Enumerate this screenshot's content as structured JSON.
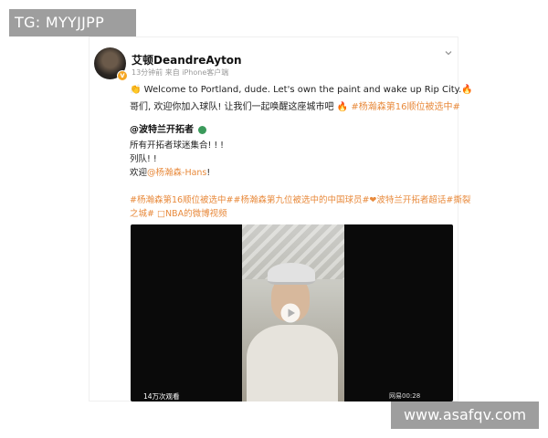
{
  "watermarks": {
    "top": "TG: MYYJJPP",
    "bottom": "www.asafqv.com"
  },
  "post": {
    "author": "艾顿DeandreAyton",
    "meta": "13分钟前 来自 iPhone客户端",
    "line1_prefix": "Welcome to Portland, dude. Let's own the paint and wake up Rip City.",
    "line2_text": "哥们, 欢迎你加入球队! 让我们一起唤醒这座城市吧",
    "line2_tag": "#杨瀚森第16顺位被选中#",
    "quote": {
      "author": "@波特兰开拓者",
      "lines": [
        "所有开拓者球迷集合! ! !",
        "列队! !"
      ],
      "welcome_prefix": "欢迎",
      "welcome_mention": "@杨瀚森-Hans",
      "welcome_suffix": "!"
    },
    "tags_line1": "#杨瀚森第16顺位被选中##杨瀚森第九位被选中的中国球员#❤波特兰开拓者超话#撕裂",
    "tags_line2": "之城# □NBA的微博视频",
    "video": {
      "views": "14万次观看",
      "source": "网易00:28"
    }
  },
  "colors": {
    "accent_orange": "#e88a3c",
    "mention_blue": "#5a87c2",
    "verified_badge": "#f5a623"
  },
  "icons": {
    "more": "chevron-down-icon",
    "play": "play-icon",
    "verified": "verified-badge-icon"
  }
}
